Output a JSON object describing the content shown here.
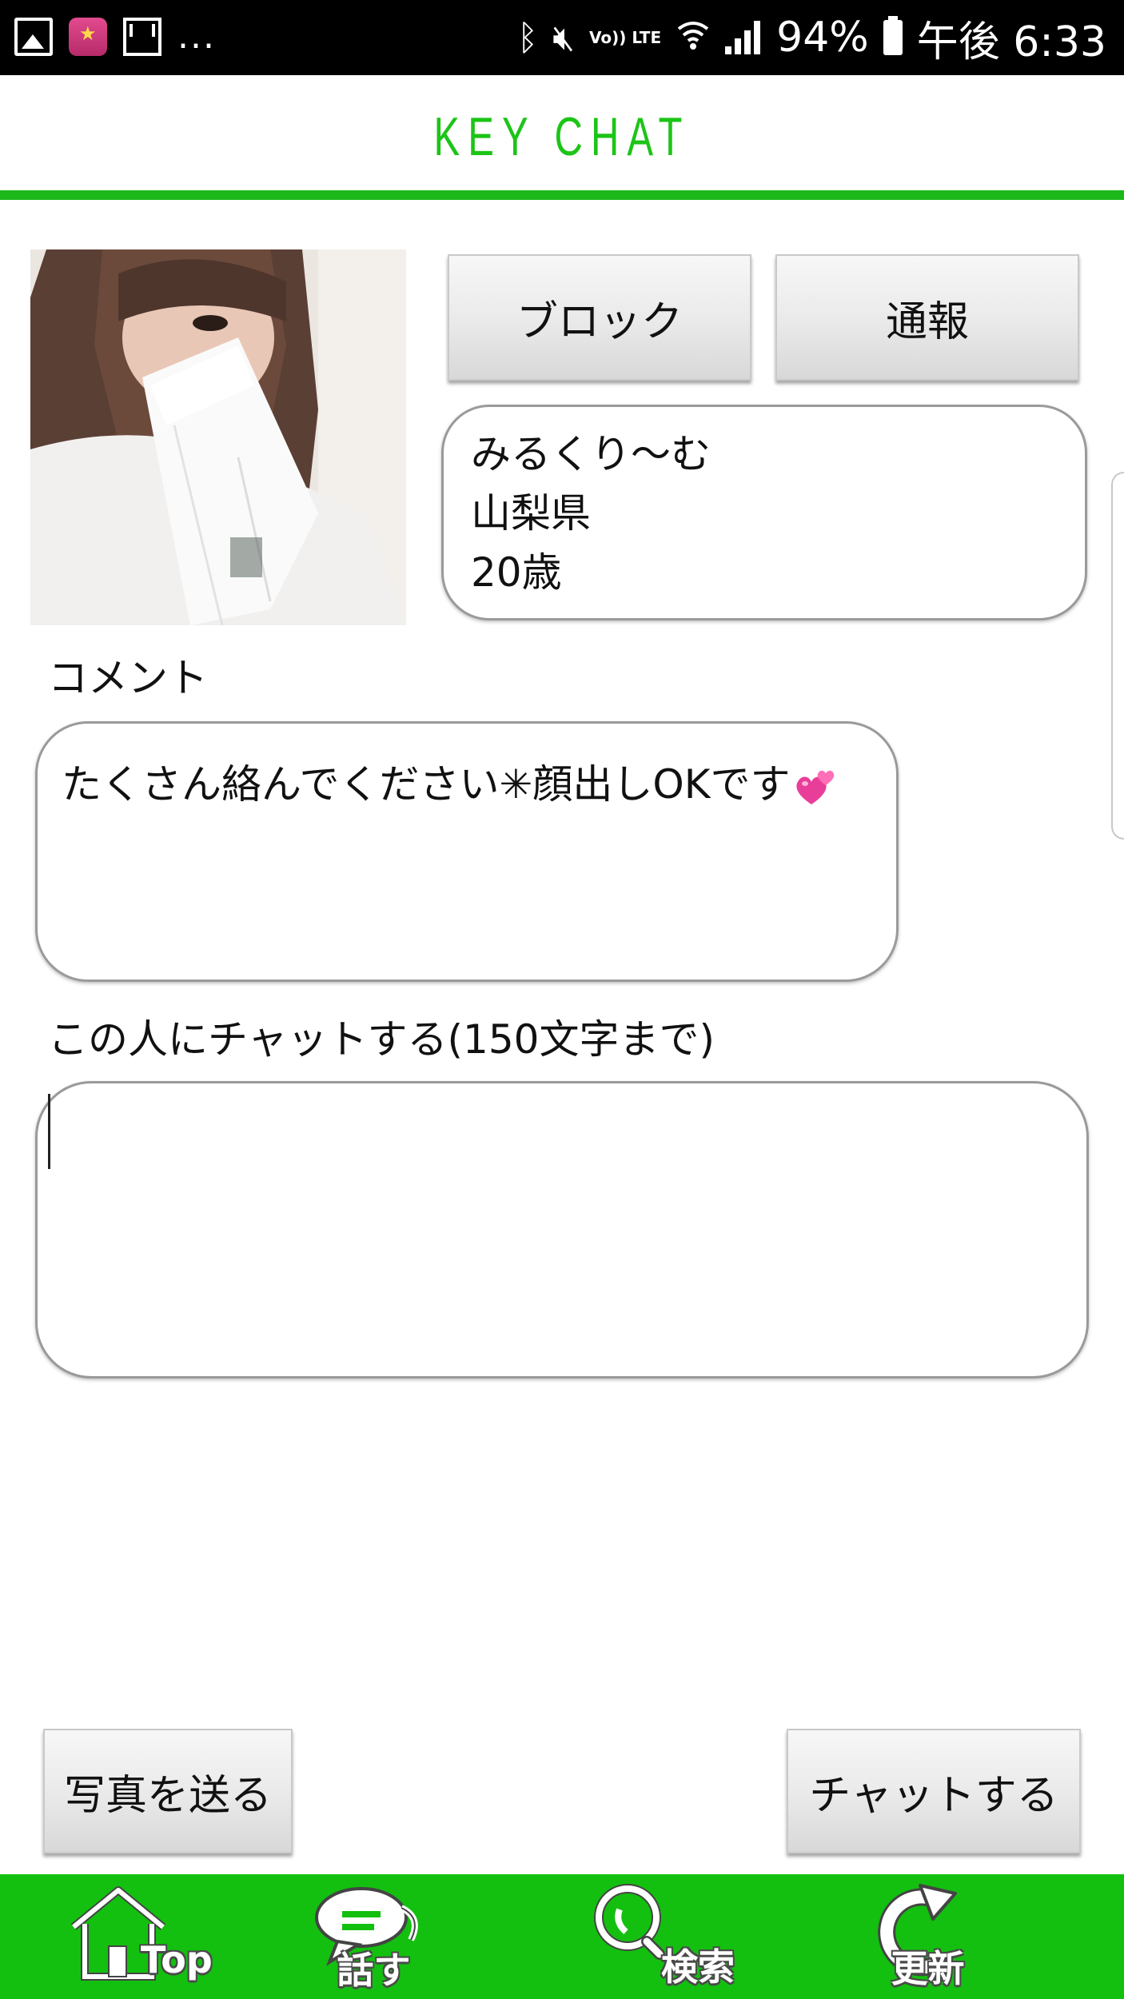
{
  "status_bar": {
    "battery": "94%",
    "time": "午後 6:33",
    "network": "Vo)) LTE",
    "left_icons": [
      "image-icon",
      "app-icon",
      "mail-icon"
    ],
    "overflow": "..."
  },
  "header": {
    "title": "KEY CHAT"
  },
  "actions": {
    "block_label": "ブロック",
    "report_label": "通報"
  },
  "profile": {
    "name": "みるくり〜む",
    "prefecture": "山梨県",
    "age": "20歳"
  },
  "comment": {
    "label": "コメント",
    "text": "たくさん絡んでください✳︎顔出しOKです"
  },
  "chat": {
    "label": "この人にチャットする(150文字まで)",
    "value": "",
    "placeholder": ""
  },
  "buttons": {
    "send_photo": "写真を送る",
    "send_chat": "チャットする"
  },
  "nav": [
    {
      "label": "Top",
      "icon": "home-icon"
    },
    {
      "label": "話す",
      "icon": "speech-bubble-icon"
    },
    {
      "label": "検索",
      "icon": "search-icon"
    },
    {
      "label": "更新",
      "icon": "refresh-icon"
    }
  ],
  "colors": {
    "brand_green": "#1cc417",
    "nav_green": "#13c00f",
    "header_line": "#1cb81a"
  }
}
